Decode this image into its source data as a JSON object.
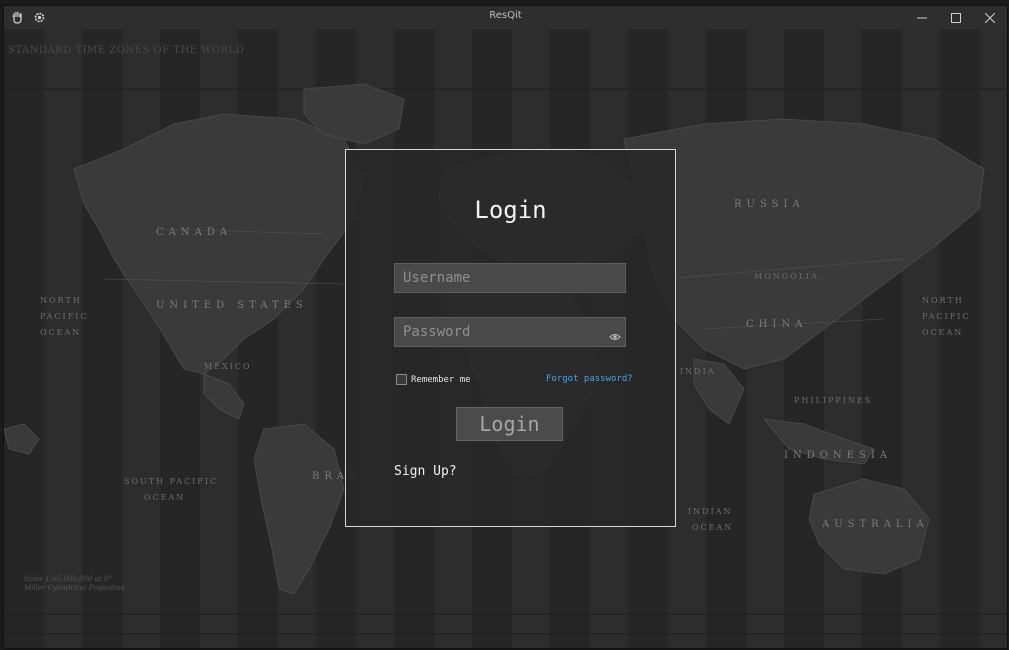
{
  "window": {
    "title": "ResQit"
  },
  "titlebar": {
    "icons": [
      "hand-icon",
      "gear-icon"
    ],
    "controls": [
      "minimize-icon",
      "maximize-icon",
      "close-icon"
    ]
  },
  "map": {
    "title": "STANDARD TIME ZONES OF THE WORLD",
    "labels": {
      "canada": "CANADA",
      "united_states": "UNITED STATES",
      "north_pacific_left": "NORTH",
      "pacific_left": "PACIFIC",
      "ocean_left": "OCEAN",
      "south_pacific": "SOUTH PACIFIC",
      "ocean_south": "OCEAN",
      "russia": "RUSSIA",
      "mongolia": "MONGOLIA",
      "china": "CHINA",
      "india": "INDIA",
      "indonesia": "INDONESIA",
      "australia": "AUSTRALIA",
      "north_right": "NORTH",
      "pacific_right": "PACIFIC",
      "ocean_right": "OCEAN",
      "mexico": "MEXICO",
      "indian": "INDIAN",
      "ocean_indian": "OCEAN",
      "brazil": "BRAZ",
      "philippines": "PHILIPPINES"
    },
    "scale_line1": "Scale 1:65,000,000 at 0°",
    "scale_line2": "Miller Cylindrical Projection"
  },
  "login": {
    "heading": "Login",
    "username_placeholder": "Username",
    "password_placeholder": "Password",
    "remember_label": "Remember me",
    "remember_checked": false,
    "forgot_label": "Forgot password?",
    "button_label": "Login",
    "signup_label": "Sign Up?"
  },
  "colors": {
    "link": "#3fa9e8",
    "panel_border": "#d8d8d8",
    "background": "#232323"
  }
}
